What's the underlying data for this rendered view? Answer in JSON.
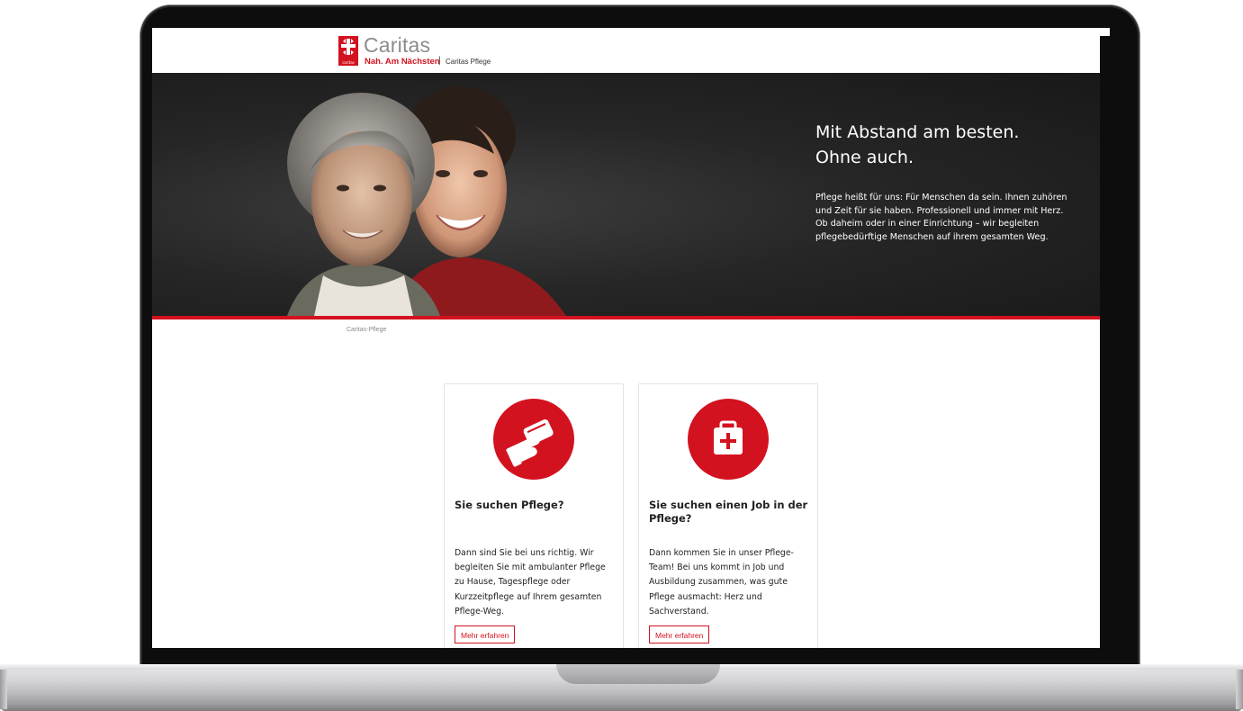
{
  "header": {
    "brand_name": "Caritas",
    "tagline": "Nah. Am Nächsten",
    "separator": "|",
    "subsite": "Caritas Pflege",
    "logo_small_text": "caritas"
  },
  "hero": {
    "title_line1": "Mit Abstand am besten.",
    "title_line2": "Ohne auch.",
    "text": "Pflege heißt für uns: Für Menschen da sein. Ihnen zuhören und Zeit für sie haben. Professionell und immer mit Herz. Ob daheim oder in einer Einrichtung – wir begleiten pflegebedürftige Menschen auf ihrem gesamten Weg."
  },
  "breadcrumb": "Caritas-Pflege",
  "cards": [
    {
      "icon": "handshake-icon",
      "title": "Sie suchen Pflege?",
      "text": "Dann sind Sie bei uns richtig. Wir begleiten Sie mit ambulanter Pflege zu Hause, Tagespflege oder Kurzzeitpflege auf Ihrem gesamten Pflege-Weg.",
      "button": "Mehr erfahren"
    },
    {
      "icon": "first-aid-kit-icon",
      "title": "Sie suchen einen Job in der Pflege?",
      "text": "Dann kommen Sie in unser Pflege-Team! Bei uns kommt in Job und Ausbildung zusammen, was gute Pflege ausmacht: Herz und Sachverstand.",
      "button": "Mehr erfahren"
    }
  ],
  "colors": {
    "brand_red": "#d3121f",
    "hero_bg": "#262626",
    "text": "#222222"
  }
}
